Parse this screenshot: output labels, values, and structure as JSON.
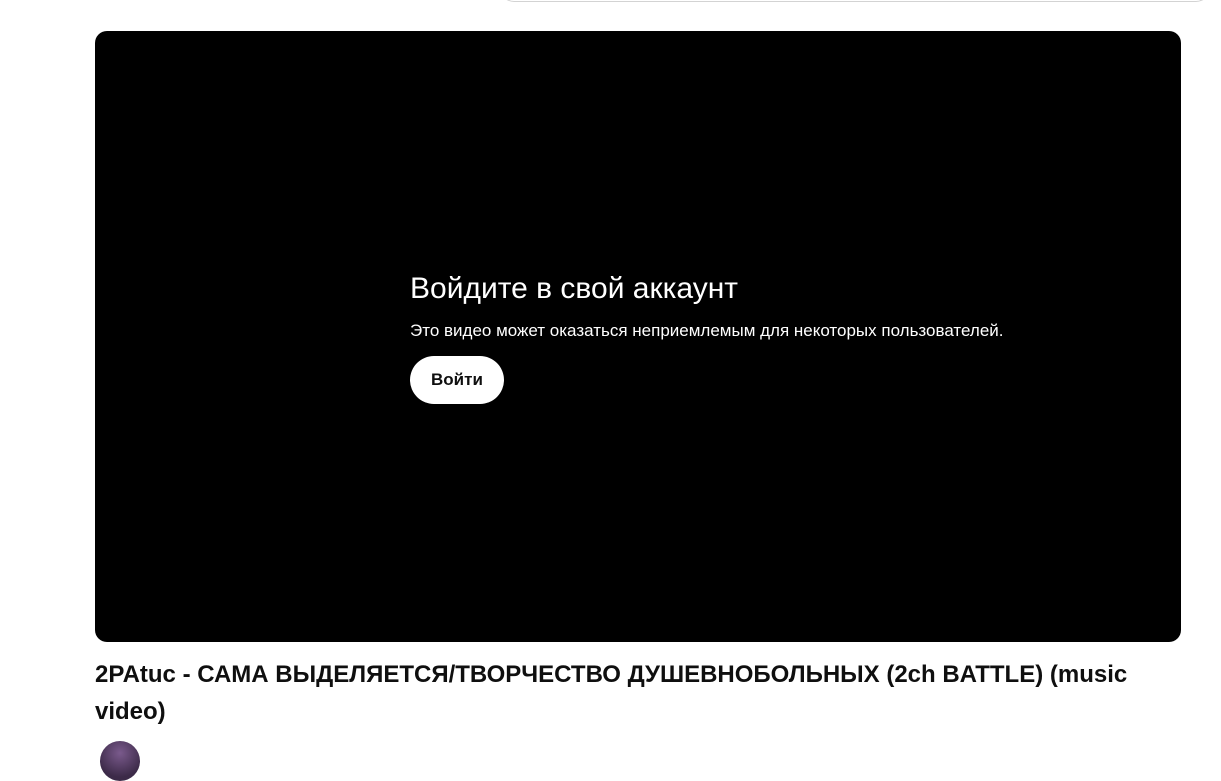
{
  "player": {
    "gate_title": "Войдите в свой аккаунт",
    "gate_message": "Это видео может оказаться неприемлемым для некоторых пользователей.",
    "login_button": "Войти"
  },
  "video": {
    "title": "2PAtuc - САМА ВЫДЕЛЯЕТСЯ/ТВОРЧЕСТВО ДУШЕВНОБОЛЬНЫХ (2ch BATTLE) (music video)"
  },
  "colors": {
    "player_background": "#000000",
    "page_background": "#ffffff",
    "text_primary": "#0f0f0f"
  }
}
